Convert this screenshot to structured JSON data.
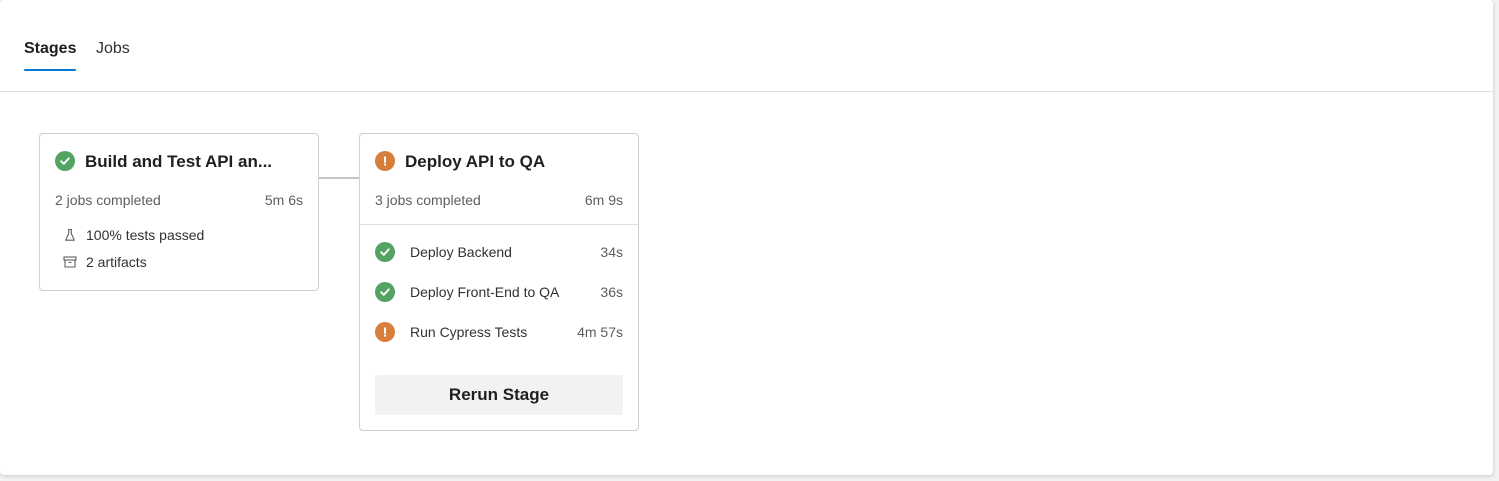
{
  "tabs": {
    "stages_label": "Stages",
    "jobs_label": "Jobs"
  },
  "colors": {
    "accent": "#0078d4",
    "success": "#55a362",
    "warning": "#d67f3c"
  },
  "stages": [
    {
      "title": "Build and Test API an...",
      "status": "success",
      "status_icon": "check-circle-icon",
      "jobs_completed": "2 jobs completed",
      "duration": "5m 6s",
      "summary": [
        {
          "icon": "flask-icon",
          "label": "100% tests passed"
        },
        {
          "icon": "artifact-box-icon",
          "label": "2 artifacts"
        }
      ]
    },
    {
      "title": "Deploy API to QA",
      "status": "warning",
      "status_icon": "warning-circle-icon",
      "jobs_completed": "3 jobs completed",
      "duration": "6m 9s",
      "jobs": [
        {
          "name": "Deploy Backend",
          "duration": "34s",
          "status": "success",
          "icon": "check-circle-icon"
        },
        {
          "name": "Deploy Front-End to QA",
          "duration": "36s",
          "status": "success",
          "icon": "check-circle-icon"
        },
        {
          "name": "Run Cypress Tests",
          "duration": "4m 57s",
          "status": "warning",
          "icon": "warning-circle-icon"
        }
      ],
      "rerun_label": "Rerun Stage"
    }
  ]
}
